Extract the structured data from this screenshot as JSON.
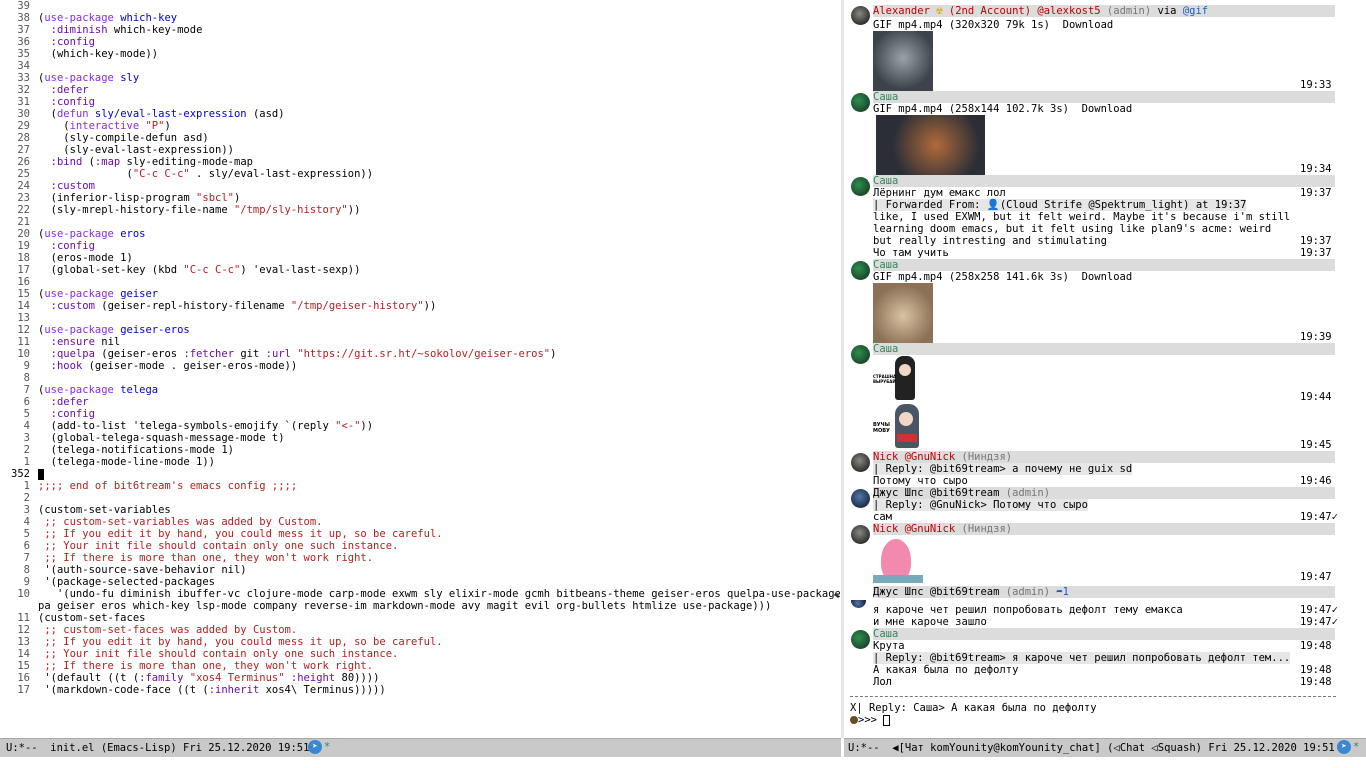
{
  "editor": {
    "lines": [
      {
        "num": "39",
        "html": ""
      },
      {
        "num": "38",
        "html": "<span class=\"ctxt\">(</span><span class=\"kw\">use-package</span> <span class=\"fn\">which-key</span>"
      },
      {
        "num": "37",
        "html": "  <span class=\"sym\">:diminish</span> which-key-mode"
      },
      {
        "num": "36",
        "html": "  <span class=\"sym\">:config</span>"
      },
      {
        "num": "35",
        "html": "  (which-key-mode))"
      },
      {
        "num": "34",
        "html": ""
      },
      {
        "num": "33",
        "html": "(<span class=\"kw\">use-package</span> <span class=\"fn\">sly</span>"
      },
      {
        "num": "32",
        "html": "  <span class=\"sym\">:defer</span>"
      },
      {
        "num": "31",
        "html": "  <span class=\"sym\">:config</span>"
      },
      {
        "num": "30",
        "html": "  (<span class=\"kw\">defun</span> <span class=\"fn\">sly/eval-last-expression</span> (asd)"
      },
      {
        "num": "29",
        "html": "    (<span class=\"kw\">interactive</span> <span class=\"str\">\"P\"</span>)"
      },
      {
        "num": "28",
        "html": "    (sly-compile-defun asd)"
      },
      {
        "num": "27",
        "html": "    (sly-eval-last-expression))"
      },
      {
        "num": "26",
        "html": "  <span class=\"sym\">:bind</span> (<span class=\"sym\">:map</span> sly-editing-mode-map"
      },
      {
        "num": "25",
        "html": "              (<span class=\"str\">\"C-c C-c\"</span> . sly/eval-last-expression))"
      },
      {
        "num": "24",
        "html": "  <span class=\"sym\">:custom</span>"
      },
      {
        "num": "23",
        "html": "  (inferior-lisp-program <span class=\"str\">\"sbcl\"</span>)"
      },
      {
        "num": "22",
        "html": "  (sly-mrepl-history-file-name <span class=\"str\">\"/tmp/sly-history\"</span>))"
      },
      {
        "num": "21",
        "html": ""
      },
      {
        "num": "20",
        "html": "(<span class=\"kw\">use-package</span> <span class=\"fn\">eros</span>"
      },
      {
        "num": "19",
        "html": "  <span class=\"sym\">:config</span>"
      },
      {
        "num": "18",
        "html": "  (eros-mode 1)"
      },
      {
        "num": "17",
        "html": "  (global-set-key (kbd <span class=\"str\">\"C-c C-c\"</span>) 'eval-last-sexp))"
      },
      {
        "num": "16",
        "html": ""
      },
      {
        "num": "15",
        "html": "(<span class=\"kw\">use-package</span> <span class=\"fn\">geiser</span>"
      },
      {
        "num": "14",
        "html": "  <span class=\"sym\">:custom</span> (geiser-repl-history-filename <span class=\"str\">\"/tmp/geiser-history\"</span>))"
      },
      {
        "num": "13",
        "html": ""
      },
      {
        "num": "12",
        "html": "(<span class=\"kw\">use-package</span> <span class=\"fn\">geiser-eros</span>"
      },
      {
        "num": "11",
        "html": "  <span class=\"sym\">:ensure</span> nil"
      },
      {
        "num": "10",
        "html": "  <span class=\"sym\">:quelpa</span> (geiser-eros <span class=\"sym\">:fetcher</span> git <span class=\"sym\">:url</span> <span class=\"str\">\"https://git.sr.ht/~sokolov/geiser-eros\"</span>)"
      },
      {
        "num": "9",
        "html": "  <span class=\"sym\">:hook</span> (geiser-mode . geiser-eros-mode))"
      },
      {
        "num": "8",
        "html": ""
      },
      {
        "num": "7",
        "html": "(<span class=\"kw\">use-package</span> <span class=\"fn\">telega</span>"
      },
      {
        "num": "6",
        "html": "  <span class=\"sym\">:defer</span>"
      },
      {
        "num": "5",
        "html": "  <span class=\"sym\">:config</span>"
      },
      {
        "num": "4",
        "html": "  (add-to-list 'telega-symbols-emojify `(reply <span class=\"str\">\"&lt;-\"</span>))"
      },
      {
        "num": "3",
        "html": "  (global-telega-squash-message-mode t)"
      },
      {
        "num": "2",
        "html": "  (telega-notifications-mode 1)"
      },
      {
        "num": "1",
        "html": "  (telega-mode-line-mode 1))"
      },
      {
        "num": "352",
        "html": "<span id=\"cursor\"></span>",
        "cur": true
      },
      {
        "num": "1",
        "html": "<span class=\"cmt\">;;;; end of bit6tream's emacs config ;;;;</span>"
      },
      {
        "num": "2",
        "html": ""
      },
      {
        "num": "3",
        "html": "(custom-set-variables"
      },
      {
        "num": "4",
        "html": " <span class=\"cmt\">;; custom-set-variables was added by Custom.</span>"
      },
      {
        "num": "5",
        "html": " <span class=\"cmt\">;; If you edit it by hand, you could mess it up, so be careful.</span>"
      },
      {
        "num": "6",
        "html": " <span class=\"cmt\">;; Your init file should contain only one such instance.</span>"
      },
      {
        "num": "7",
        "html": " <span class=\"cmt\">;; If there is more than one, they won't work right.</span>"
      },
      {
        "num": "8",
        "html": " '(auth-source-save-behavior nil)"
      },
      {
        "num": "9",
        "html": " '(package-selected-packages"
      },
      {
        "num": "10",
        "html": "   '(undo-fu diminish ibuffer-vc clojure-mode carp-mode exwm sly elixir-mode gcmh bitbeans-theme geiser-eros quelpa-use-package quel"
      },
      {
        "num": "",
        "html": "pa geiser eros which-key lsp-mode company reverse-im markdown-mode avy magit evil org-bullets htmlize use-package)))"
      },
      {
        "num": "11",
        "html": "(custom-set-faces"
      },
      {
        "num": "12",
        "html": " <span class=\"cmt\">;; custom-set-faces was added by Custom.</span>"
      },
      {
        "num": "13",
        "html": " <span class=\"cmt\">;; If you edit it by hand, you could mess it up, so be careful.</span>"
      },
      {
        "num": "14",
        "html": " <span class=\"cmt\">;; Your init file should contain only one such instance.</span>"
      },
      {
        "num": "15",
        "html": " <span class=\"cmt\">;; If there is more than one, they won't work right.</span>"
      },
      {
        "num": "16",
        "html": " '(default ((t (<span class=\"sym\">:family</span> <span class=\"str\">\"xos4 Terminus\"</span> <span class=\"sym\">:height</span> 80))))"
      },
      {
        "num": "17",
        "html": " '(markdown-code-face ((t (<span class=\"sym\">:inherit</span> xos4\\ Terminus)))))"
      }
    ]
  },
  "chat": {
    "msg1": {
      "name": "Alexander",
      "extra": " (2nd Account) @alexkost5",
      "role": " (admin)",
      "via": " via ",
      "bot": "@gif",
      "file": "GIF mp4.mp4 (320x320 79k 1s)  Download",
      "time": "19:33"
    },
    "msg2": {
      "name": "Саша",
      "file": "GIF mp4.mp4 (258x144 102.7k 3s)  Download",
      "time": "19:34"
    },
    "msg3": {
      "name": "Саша",
      "text1": "Лёрнинг дум емакс лол",
      "time1": "19:37",
      "fwd": "| Forwarded From: 👤(Cloud Strife @Spektrum_light) at 19:37",
      "text2": "like, I used EXWM, but it felt weird. Maybe it's because i'm still",
      "text3": "learning doom emacs, but it felt using like plan9's acme: weird",
      "text4": "but really intresting and stimulating",
      "time2": "19:37",
      "text5": "Чо там учить",
      "time3": "19:37"
    },
    "msg4": {
      "name": "Саша",
      "file": "GIF mp4.mp4 (258x258 141.6k 3s)  Download",
      "time": "19:39"
    },
    "msg5": {
      "name": "Саша",
      "time1": "19:44",
      "time2": "19:45",
      "sticker1": "СТРАШНА ВЫРУБАЙ",
      "sticker2": "ВУЧЫ МОВУ"
    },
    "msg6": {
      "name": "Nick @GnuNick",
      "role": " (Ниндзя)",
      "reply": "| Reply: @bit69tream> а почему не guix sd",
      "text": "Потому что сыро",
      "time": "19:46"
    },
    "msg7": {
      "name": "Джус Шпс @bit69tream",
      "role": " (admin)",
      "reply": "| Reply: @GnuNick> Потому что сыро",
      "text": "сам",
      "time": "19:47✓"
    },
    "msg8": {
      "name": "Nick @GnuNick",
      "role": " (Ниндзя)",
      "time": "19:47"
    },
    "msg9": {
      "name": "Джус Шпс @bit69tream",
      "role": " (admin)",
      "reply_icon": " ➦1",
      "text1": "я кароче чет решил попробовать дефолт тему емакса",
      "time1": "19:47✓",
      "text2": "и мне кароче зашло",
      "time2": "19:47✓"
    },
    "msg10": {
      "name": "Саша",
      "text1": "Крута",
      "time1": "19:48",
      "reply": "| Reply: @bit69tream> я кароче чет решил попробовать дефолт тем...",
      "text2": "А какая была по дефолту",
      "time2": "19:48",
      "text3": "Лол",
      "time3": "19:48"
    },
    "input": {
      "reply": "X| Reply: Саша> А какая была по дефолту",
      "prompt": ">>> "
    }
  },
  "modeline_left": {
    "text": "U:*--  init.el (Emacs-Lisp) Fri 25.12.2020 19:51"
  },
  "modeline_right": {
    "text": "U:*--  ◀[Чат komYounity@komYounity_chat] (◁Chat ◁Squash) Fri 25.12.2020 19:51"
  },
  "colors": {
    "accent": "#3a88d4",
    "modeline": "#c9c9c9"
  }
}
